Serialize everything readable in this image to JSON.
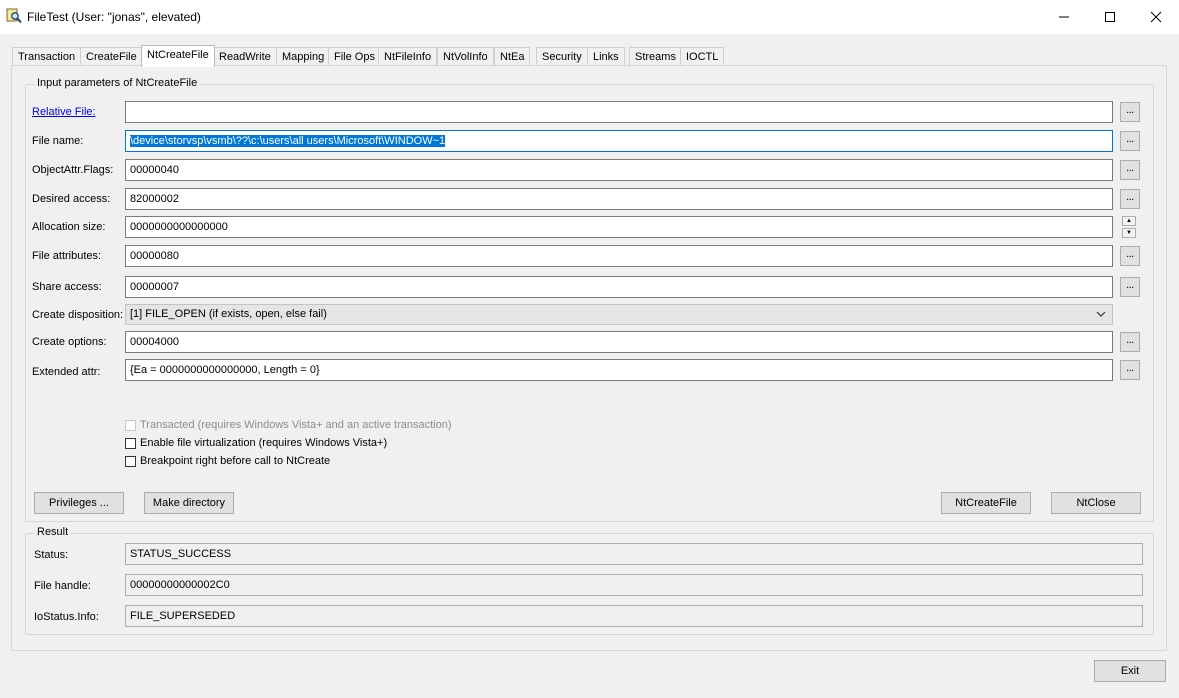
{
  "window": {
    "title": "FileTest (User: \"jonas\", elevated)",
    "minimize_label": "Minimize",
    "maximize_label": "Maximize",
    "close_label": "Close"
  },
  "tabs": [
    {
      "label": "Transaction"
    },
    {
      "label": "CreateFile"
    },
    {
      "label": "NtCreateFile",
      "active": true
    },
    {
      "label": "ReadWrite"
    },
    {
      "label": "Mapping"
    },
    {
      "label": "File Ops"
    },
    {
      "label": "NtFileInfo"
    },
    {
      "label": "NtVolInfo"
    },
    {
      "label": "NtEa"
    },
    {
      "label": "Security"
    },
    {
      "label": "Links"
    },
    {
      "label": "Streams"
    },
    {
      "label": "IOCTL"
    }
  ],
  "input_group": {
    "title": "Input parameters of NtCreateFile",
    "relative_file": {
      "label": "Relative File:",
      "value": ""
    },
    "file_name": {
      "label": "File name:",
      "value": "\\device\\storvsp\\vsmb\\??\\c:\\users\\all users\\Microsoft\\WINDOW~1"
    },
    "object_attr_flags": {
      "label": "ObjectAttr.Flags:",
      "value": "00000040"
    },
    "desired_access": {
      "label": "Desired access:",
      "value": "82000002"
    },
    "allocation_size": {
      "label": "Allocation size:",
      "value": "0000000000000000"
    },
    "file_attributes": {
      "label": "File attributes:",
      "value": "00000080"
    },
    "share_access": {
      "label": "Share access:",
      "value": "00000007"
    },
    "create_disposition": {
      "label": "Create disposition:",
      "value": "[1] FILE_OPEN (if exists, open, else fail)"
    },
    "create_options": {
      "label": "Create options:",
      "value": "00004000"
    },
    "extended_attr": {
      "label": "Extended attr:",
      "value": "{Ea = 0000000000000000, Length = 0}"
    },
    "browse_label": "...",
    "checkboxes": {
      "transacted": "Transacted (requires Windows Vista+ and an active transaction)",
      "virtualization": "Enable file virtualization (requires Windows Vista+)",
      "breakpoint": "Breakpoint right before call to NtCreate"
    },
    "buttons": {
      "privileges": "Privileges ...",
      "make_directory": "Make directory",
      "ntcreatefile": "NtCreateFile",
      "ntclose": "NtClose"
    }
  },
  "result_group": {
    "title": "Result",
    "status": {
      "label": "Status:",
      "value": "STATUS_SUCCESS"
    },
    "file_handle": {
      "label": "File handle:",
      "value": "00000000000002C0"
    },
    "iostatus_info": {
      "label": "IoStatus.Info:",
      "value": "FILE_SUPERSEDED"
    }
  },
  "exit_label": "Exit"
}
